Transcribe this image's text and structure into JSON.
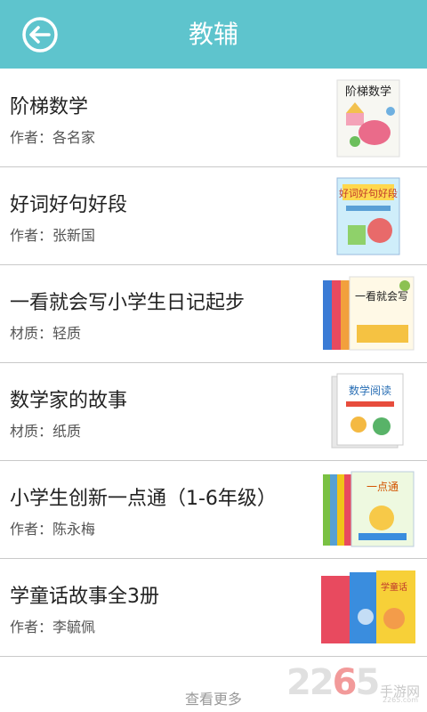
{
  "header": {
    "title": "教辅",
    "back_icon": "back-arrow-circle-icon",
    "color": "#5ec4cd"
  },
  "items": [
    {
      "title": "阶梯数学",
      "subtitle": "作者：各名家",
      "cover_text": "阶梯数学"
    },
    {
      "title": "好词好句好段",
      "subtitle": "作者：张新国",
      "cover_text": "好词好句好段"
    },
    {
      "title": "一看就会写小学生日记起步",
      "subtitle": "材质：轻质",
      "cover_text": "一看就会写"
    },
    {
      "title": "数学家的故事",
      "subtitle": "材质：纸质",
      "cover_text": "数学阅读"
    },
    {
      "title": "小学生创新一点通（1-6年级）",
      "subtitle": "作者：陈永梅",
      "cover_text": "一点通"
    },
    {
      "title": "学童话故事全3册",
      "subtitle": "作者：李毓佩",
      "cover_text": "学童话"
    }
  ],
  "footer": {
    "more_label": "查看更多"
  },
  "watermark": {
    "number": "2265",
    "sub": "手游网",
    "url": "2265.com"
  }
}
